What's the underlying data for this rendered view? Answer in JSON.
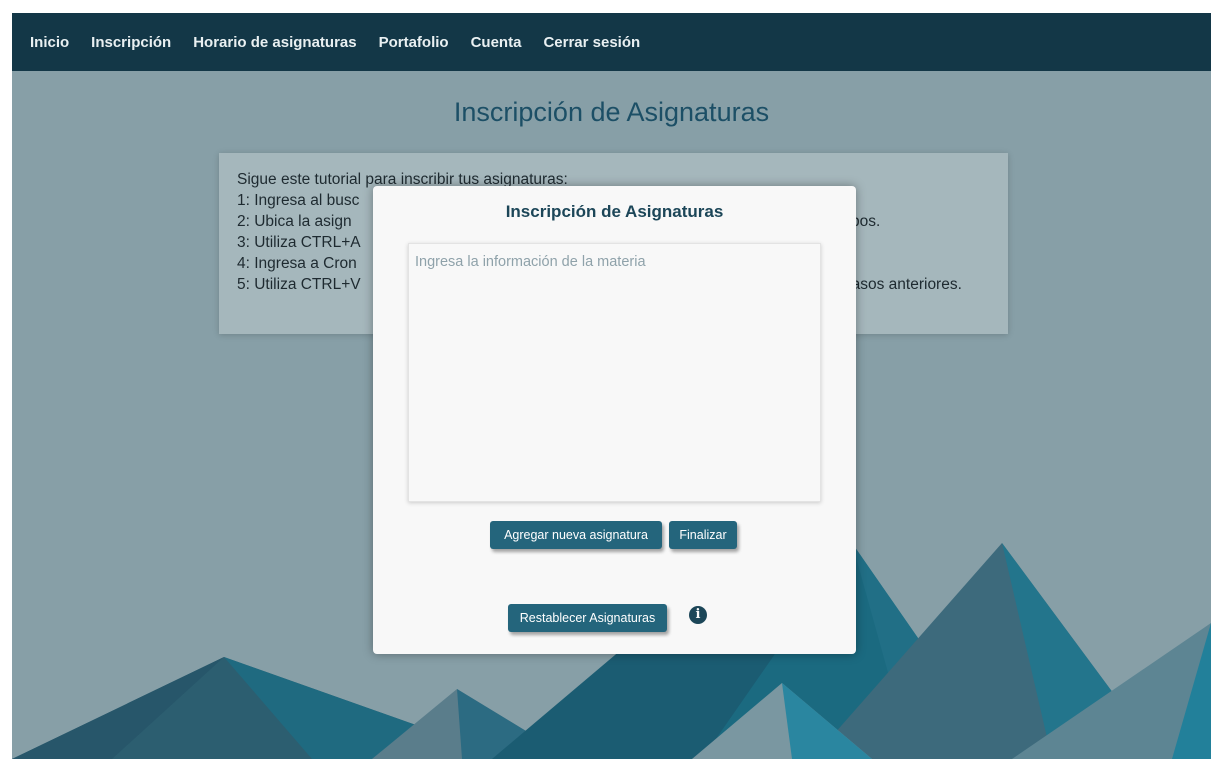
{
  "nav": {
    "items": [
      "Inicio",
      "Inscripción",
      "Horario de asignaturas",
      "Portafolio",
      "Cuenta",
      "Cerrar sesión"
    ]
  },
  "page": {
    "title": "Inscripción de Asignaturas"
  },
  "tutorial": {
    "lines": [
      "Sigue este tutorial para inscribir tus asignaturas:",
      "1: Ingresa al busc",
      "2: Ubica la asign",
      "3: Utiliza CTRL+A",
      "4: Ingresa a Cron",
      "5: Utiliza CTRL+V"
    ],
    "line2_tail": "pos.",
    "line5_tail": "pasos anteriores."
  },
  "modal": {
    "title": "Inscripción de Asignaturas",
    "textarea_value": "",
    "textarea_placeholder": "Ingresa la información de la materia",
    "add_button": "Agregar nueva asignatura",
    "finish_button": "Finalizar",
    "reset_button": "Restablecer Asignaturas",
    "info_icon": "info-icon"
  },
  "colors": {
    "navbar_bg": "#133747",
    "page_bg": "#879fa7",
    "accent": "#24657c",
    "title": "#1c4f66"
  }
}
